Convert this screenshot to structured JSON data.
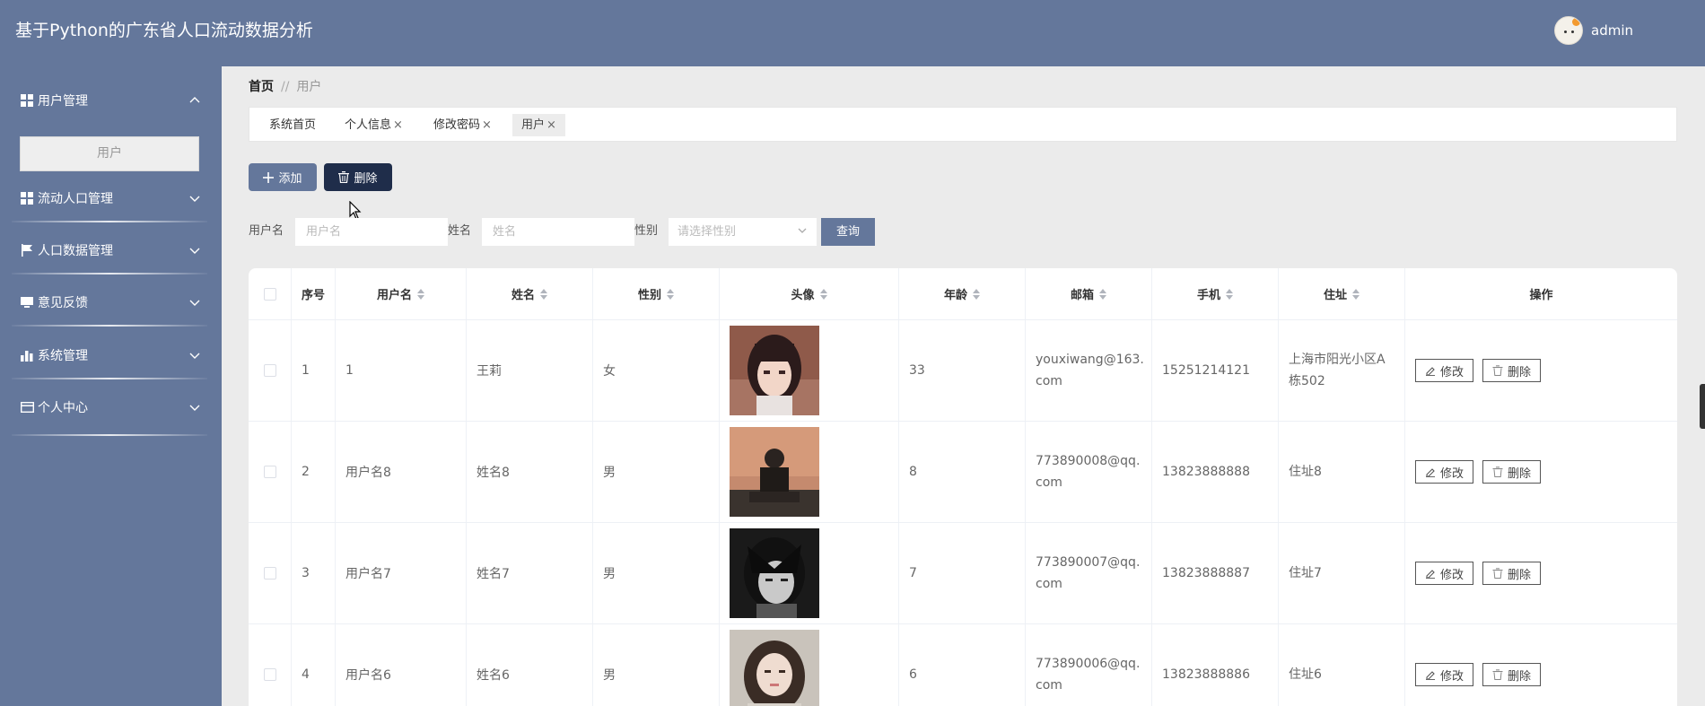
{
  "header": {
    "title": "基于Python的广东省人口流动数据分析",
    "username": "admin"
  },
  "sidebar": {
    "items": [
      {
        "label": "用户管理",
        "icon": "grid-icon"
      },
      {
        "label": "流动人口管理",
        "icon": "grid-icon"
      },
      {
        "label": "人口数据管理",
        "icon": "flag-icon"
      },
      {
        "label": "意见反馈",
        "icon": "monitor-icon"
      },
      {
        "label": "系统管理",
        "icon": "bar-chart-icon"
      },
      {
        "label": "个人中心",
        "icon": "card-icon"
      }
    ],
    "submenu_active": "用户"
  },
  "breadcrumb": {
    "home": "首页",
    "separator": "//",
    "current": "用户"
  },
  "tabs": [
    {
      "label": "系统首页",
      "closable": false
    },
    {
      "label": "个人信息",
      "closable": true
    },
    {
      "label": "修改密码",
      "closable": true
    },
    {
      "label": "用户",
      "closable": true
    }
  ],
  "close_glyph": "×",
  "toolbar": {
    "add_label": "添加",
    "delete_label": "删除"
  },
  "filters": {
    "username_label": "用户名",
    "username_placeholder": "用户名",
    "name_label": "姓名",
    "name_placeholder": "姓名",
    "gender_label": "性别",
    "gender_placeholder": "请选择性别",
    "query_label": "查询"
  },
  "table": {
    "headers": {
      "index": "序号",
      "username": "用户名",
      "name": "姓名",
      "gender": "性别",
      "avatar": "头像",
      "age": "年龄",
      "email": "邮箱",
      "phone": "手机",
      "address": "住址",
      "actions": "操作"
    },
    "rows": [
      {
        "index": "1",
        "username": "1",
        "name": "王莉",
        "gender": "女",
        "age": "33",
        "email": "youxiwang@163.com",
        "phone": "15251214121",
        "address": "上海市阳光小区A栋502"
      },
      {
        "index": "2",
        "username": "用户名8",
        "name": "姓名8",
        "gender": "男",
        "age": "8",
        "email": "773890008@qq.com",
        "phone": "13823888888",
        "address": "住址8"
      },
      {
        "index": "3",
        "username": "用户名7",
        "name": "姓名7",
        "gender": "男",
        "age": "7",
        "email": "773890007@qq.com",
        "phone": "13823888887",
        "address": "住址7"
      },
      {
        "index": "4",
        "username": "用户名6",
        "name": "姓名6",
        "gender": "男",
        "age": "6",
        "email": "773890006@qq.com",
        "phone": "13823888886",
        "address": "住址6"
      }
    ],
    "edit_label": "修改",
    "delete_label": "删除"
  }
}
